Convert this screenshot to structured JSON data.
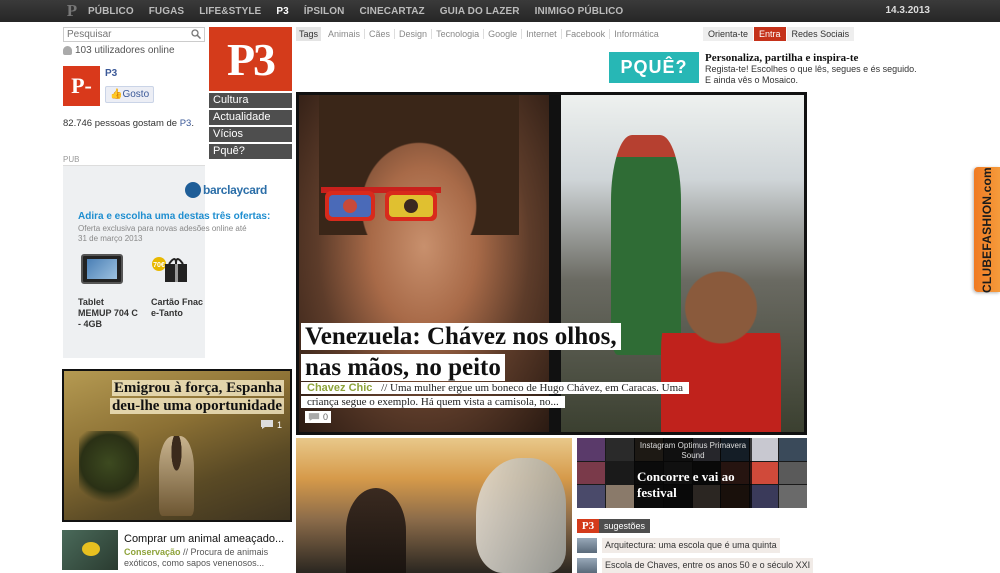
{
  "topbar": {
    "logo": "P",
    "nav": [
      "PÚBLICO",
      "FUGAS",
      "LIFE&STYLE",
      "P3",
      "ÍPSILON",
      "CINECARTAZ",
      "GUIA DO LAZER",
      "INIMIGO PÚBLICO"
    ],
    "date": "14.3.2013"
  },
  "search": {
    "placeholder": "Pesquisar"
  },
  "users_online": "103 utilizadores online",
  "facebook": {
    "logo": "P-",
    "name": "P3",
    "like_label": "Gosto",
    "count_prefix": "82.746 pessoas gostam de ",
    "count_link": "P3",
    "count_suffix": "."
  },
  "pub_label": "PUB",
  "ad": {
    "brand": "barclaycard",
    "headline": "Adira e escolha uma destas três ofertas:",
    "sub": "Oferta exclusiva para novas adesões online até 31 de março 2013",
    "item1": "Tablet MEMUP 704 C - 4GB",
    "item2": "Cartão Fnac e-Tanto",
    "gift_badge": "70€"
  },
  "p3_logo": "P3",
  "side_menu": [
    "Cultura",
    "Actualidade",
    "Vícios",
    "Pquê?"
  ],
  "tags": {
    "label": "Tags",
    "items": [
      "Animais",
      "Cães",
      "Design",
      "Tecnologia",
      "Google",
      "Internet",
      "Facebook",
      "Informática"
    ]
  },
  "auth": [
    "Orienta-te",
    "Entra",
    "Redes Sociais"
  ],
  "pque": {
    "logo": "PQUÊ?",
    "title": "Personaliza, partilha e inspira-te",
    "text": "Regista-te! Escolhes o que lês, segues e és seguido. E ainda vês o Mosaico."
  },
  "hero": {
    "title_line1": "Venezuela: Chávez nos olhos,",
    "title_line2": "nas mãos, no peito",
    "category": "Chavez Chic",
    "desc": " // Uma mulher ergue um boneco de Hugo Chávez, em Caracas. Uma criança segue o exemplo. Há quem vista a camisola, no...",
    "comments": "0"
  },
  "story_emigrou": {
    "title_line1": "Emigrou à força, Espanha",
    "title_line2": "deu-lhe uma oportunidade",
    "comments": "1"
  },
  "story_animal": {
    "title": "Comprar um animal ameaçado...",
    "category": "Conservação",
    "desc": " // Procura de animais exóticos, como sapos venenosos..."
  },
  "instagram": {
    "small": "Instagram Optimus Primavera Sound",
    "big": "Concorre e vai ao festival"
  },
  "sugestoes": {
    "logo": "P3",
    "label": "sugestões",
    "items": [
      "Arquitectura: uma escola que é uma quinta",
      "Escola de Chaves, entre os anos 50 e o século XXI"
    ]
  },
  "side_tab": "CLUBEFASHION.com",
  "colors": {
    "brand": "#d43b1b",
    "accent": "#8ea33a",
    "teal": "#27b7b5"
  }
}
